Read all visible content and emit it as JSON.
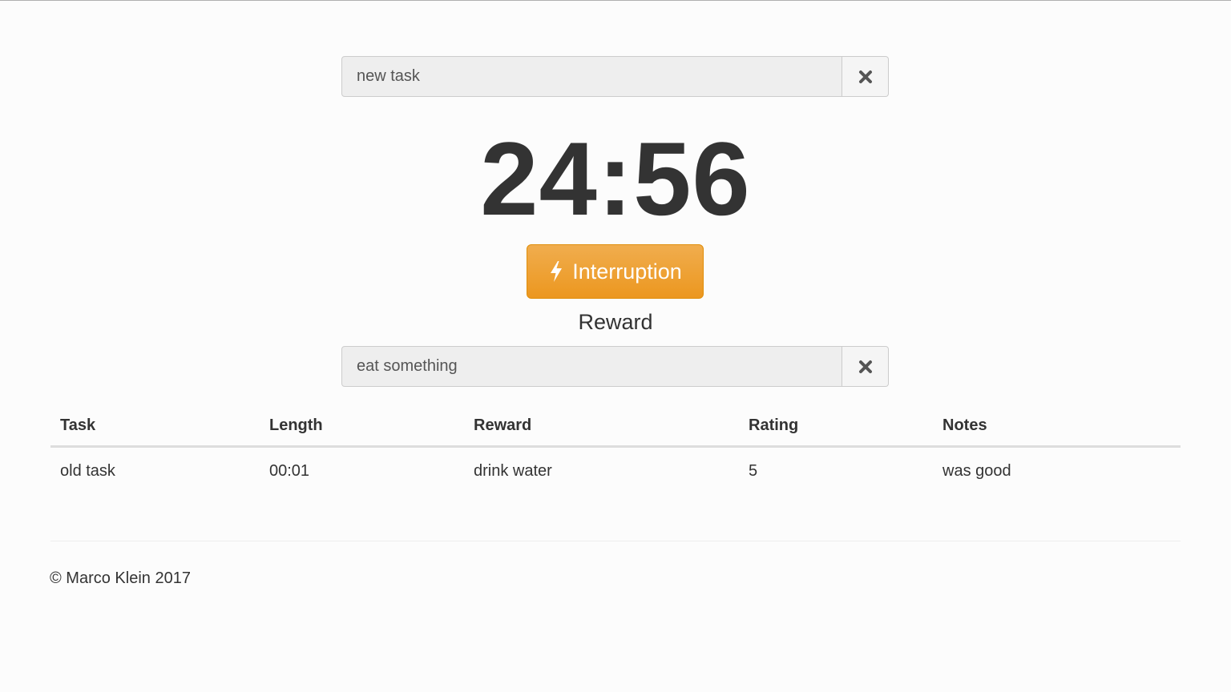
{
  "task_input": {
    "value": "new task",
    "clear_icon": "close-icon"
  },
  "timer": {
    "display": "24:56"
  },
  "interrupt_button": {
    "label": "Interruption",
    "icon": "lightning-bolt-icon",
    "color": "#f0ad4e"
  },
  "reward": {
    "heading": "Reward",
    "value": "eat something",
    "clear_icon": "close-icon"
  },
  "history_table": {
    "headers": [
      "Task",
      "Length",
      "Reward",
      "Rating",
      "Notes"
    ],
    "rows": [
      [
        "old task",
        "00:01",
        "drink water",
        "5",
        "was good"
      ]
    ]
  },
  "footer": {
    "text": "© Marco Klein 2017"
  }
}
